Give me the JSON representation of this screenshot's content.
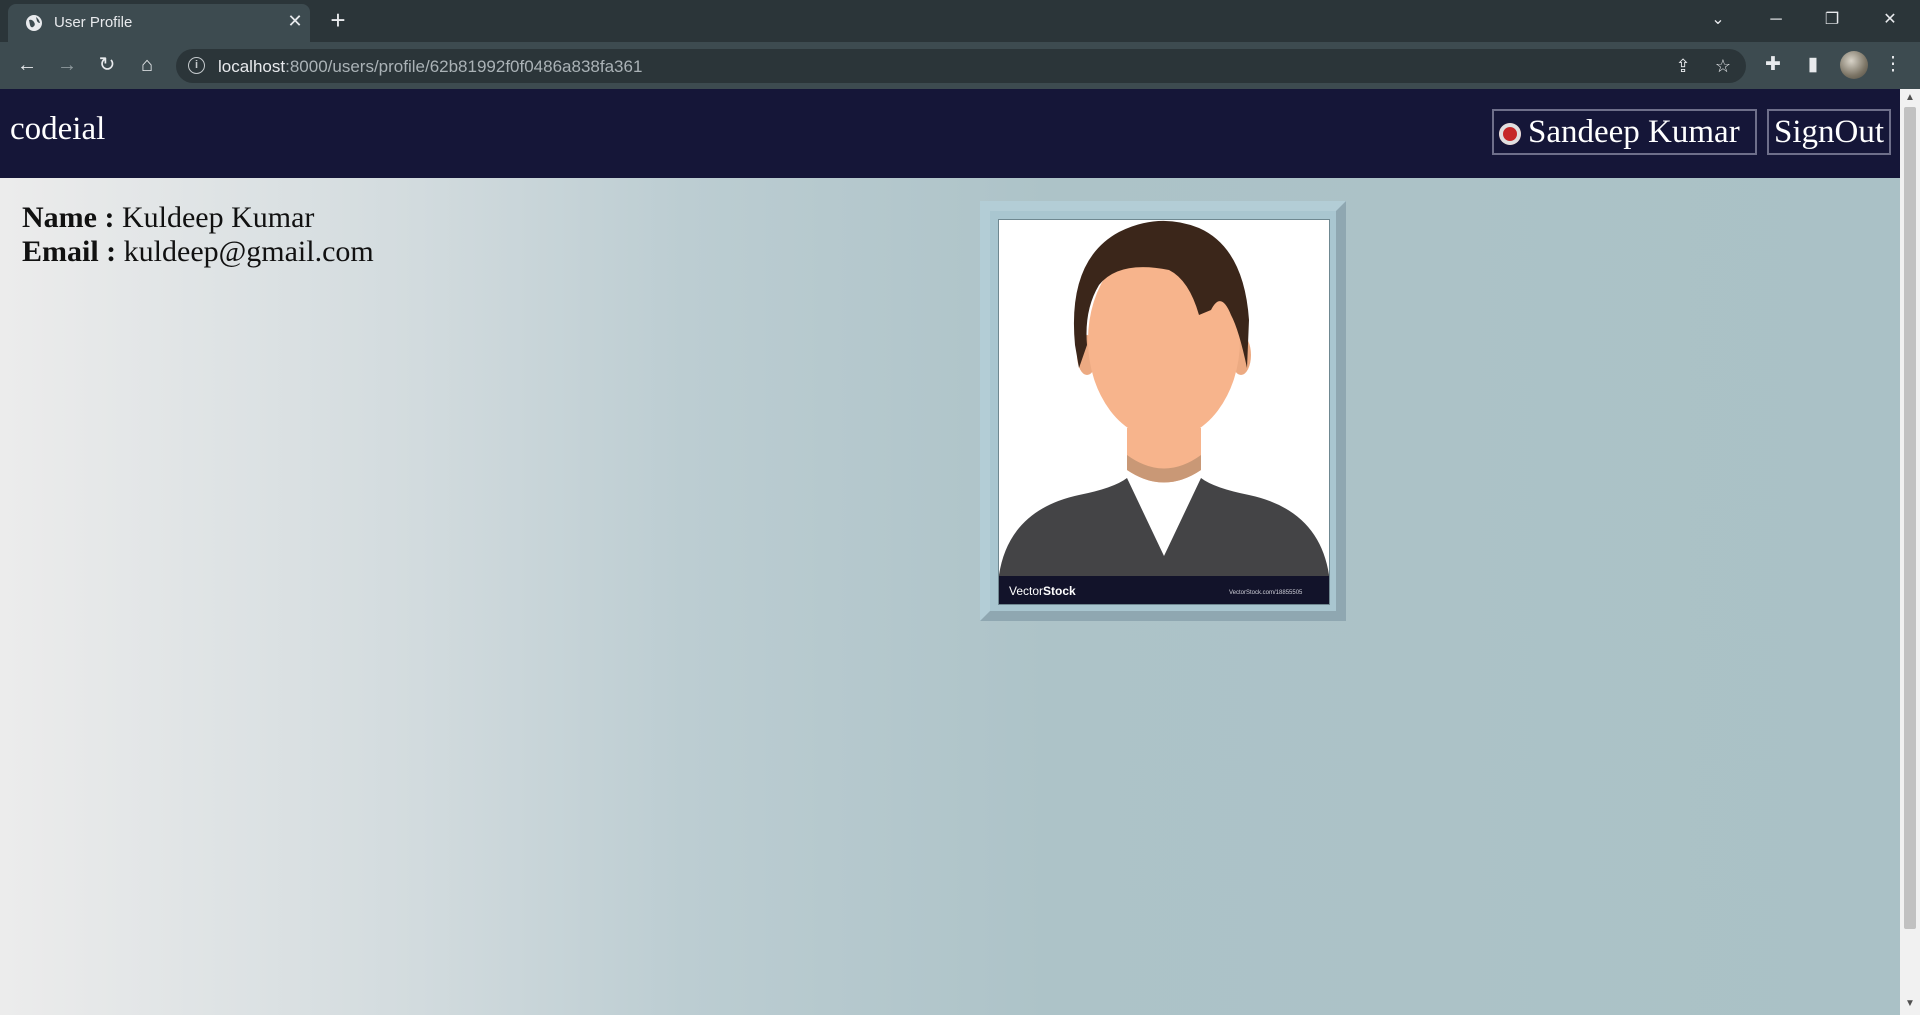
{
  "browser": {
    "tab_title": "User Profile",
    "new_tab": "+",
    "url_host": "localhost",
    "url_path": ":8000/users/profile/62b81992f0f0486a838fa361"
  },
  "site": {
    "logo": "codeial",
    "user_name": "Sandeep Kumar",
    "signout_label": "SignOut"
  },
  "profile": {
    "name_label": "Name :",
    "name_value": "Kuldeep Kumar",
    "email_label": "Email :",
    "email_value": "kuldeep@gmail.com",
    "watermark_left_a": "Vector",
    "watermark_left_b": "Stock",
    "watermark_right": "VectorStock.com/18855505"
  },
  "colors": {
    "header_bg": "#151638",
    "page_gradient_start": "#ececec",
    "page_gradient_end": "#aac1c6",
    "frame_color": "#a9c6d0"
  }
}
